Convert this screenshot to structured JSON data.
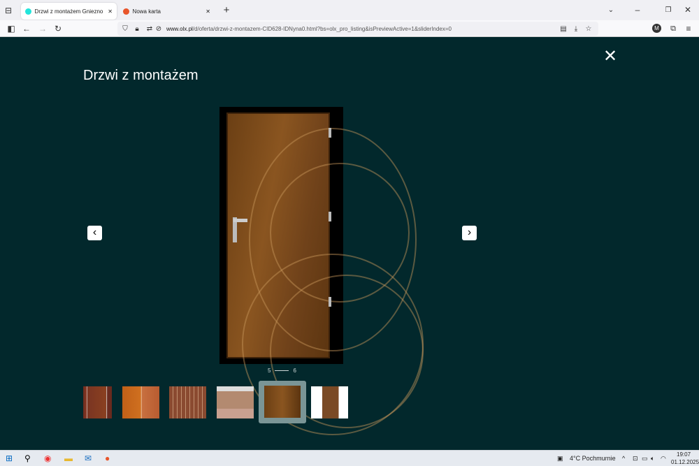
{
  "browser": {
    "tabs": [
      {
        "label": "Drzwi z montażem Gniezno • OLX",
        "active": true
      },
      {
        "label": "Nowa karta",
        "active": false
      }
    ],
    "url_domain": "www.olx.pl",
    "url_path": "/d/oferta/drzwi-z-montazem-CID628-IDNyna0.html?bs=olx_pro_listing&isPreviewActive=1&sliderIndex=0",
    "profile_initial": "M"
  },
  "gallery": {
    "title": "Drzwi z montażem",
    "current": "5",
    "total": "6",
    "selected_thumbnail": 5,
    "background": "#02282c"
  },
  "taskbar": {
    "weather": "4°C  Pochmurnie",
    "time": "19:07",
    "date": "01.12.2025"
  }
}
